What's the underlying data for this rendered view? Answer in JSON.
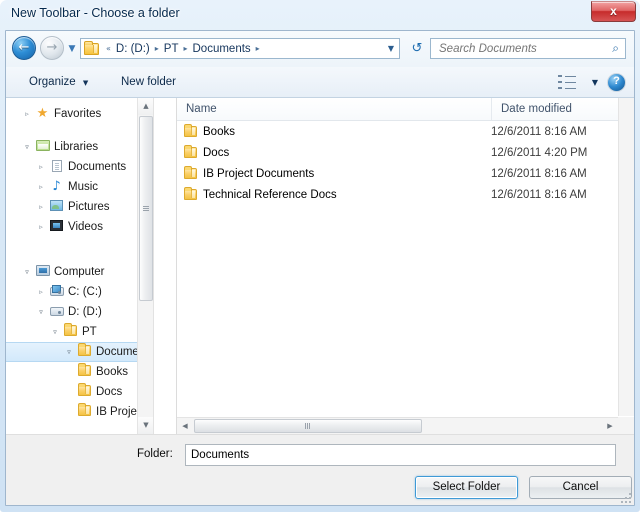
{
  "window": {
    "title": "New Toolbar - Choose a folder",
    "close_label": "x"
  },
  "nav": {
    "back_glyph": "←",
    "forward_glyph": "→",
    "recent_caret": "▼",
    "refresh_glyph": "↺",
    "address_dropdown": "▼",
    "overflow": "«",
    "separator": "▸",
    "breadcrumbs": [
      {
        "label": "D: (D:)"
      },
      {
        "label": "PT"
      },
      {
        "label": "Documents"
      }
    ]
  },
  "search": {
    "placeholder": "Search Documents",
    "value": "",
    "icon": "⌕"
  },
  "toolbar": {
    "organize_label": "Organize",
    "organize_caret": "▼",
    "new_folder_label": "New folder",
    "view_caret": "▼",
    "help_label": "?"
  },
  "sidebar": {
    "expander_closed": "▹",
    "expander_open": "▿",
    "scroll_up": "▲",
    "scroll_down": "▼",
    "items": [
      {
        "label": "Favorites"
      },
      {
        "label": "Libraries"
      },
      {
        "label": "Documents"
      },
      {
        "label": "Music"
      },
      {
        "label": "Pictures"
      },
      {
        "label": "Videos"
      },
      {
        "label": "Computer"
      },
      {
        "label": "C: (C:)"
      },
      {
        "label": "D: (D:)"
      },
      {
        "label": "PT"
      },
      {
        "label": "Documents"
      },
      {
        "label": "Books"
      },
      {
        "label": "Docs"
      },
      {
        "label": "IB Project D"
      }
    ]
  },
  "filelist": {
    "columns": [
      "Name",
      "Date modified"
    ],
    "rows": [
      {
        "name": "Books",
        "date": "12/6/2011 8:16 AM"
      },
      {
        "name": "Docs",
        "date": "12/6/2011 4:20 PM"
      },
      {
        "name": "IB Project Documents",
        "date": "12/6/2011 8:16 AM"
      },
      {
        "name": "Technical Reference Docs",
        "date": "12/6/2011 8:16 AM"
      }
    ],
    "scroll_left": "◀",
    "scroll_right": "▶"
  },
  "bottom": {
    "folder_label": "Folder:",
    "folder_value": "Documents",
    "folder_placeholder": "",
    "select_label": "Select Folder",
    "cancel_label": "Cancel"
  }
}
